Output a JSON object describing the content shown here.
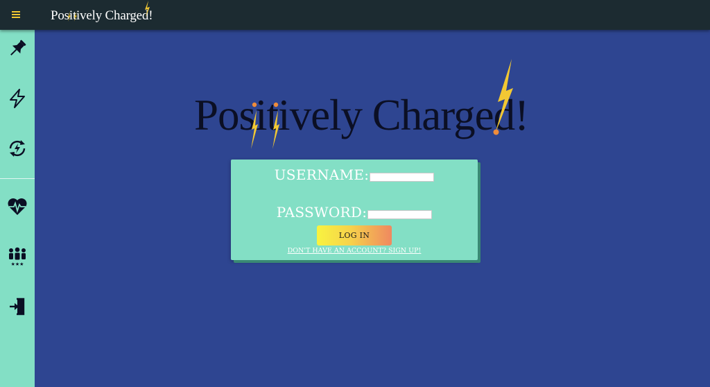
{
  "app": {
    "title": "Positively Charged",
    "title_punct": "!"
  },
  "topbar": {
    "menu_icon": "hamburger-menu-icon"
  },
  "sidebar": {
    "items": [
      {
        "icon": "pushpin-icon"
      },
      {
        "icon": "lightning-bolt-icon"
      },
      {
        "icon": "recharge-cycle-icon"
      },
      {
        "icon": "heartbeat-icon"
      },
      {
        "icon": "group-rating-icon"
      },
      {
        "icon": "logout-icon"
      }
    ]
  },
  "login": {
    "username_label": "USERNAME:",
    "username_value": "",
    "password_label": "PASSWORD:",
    "password_value": "",
    "login_button": "LOG IN",
    "signup_link": "DON'T HAVE AN ACCOUNT? SIGN UP!"
  },
  "colors": {
    "background": "#2e4591",
    "topbar": "#1c2b31",
    "accent": "#83dfc5",
    "bolt": "#f2c833",
    "dot": "#ef8c3a"
  }
}
